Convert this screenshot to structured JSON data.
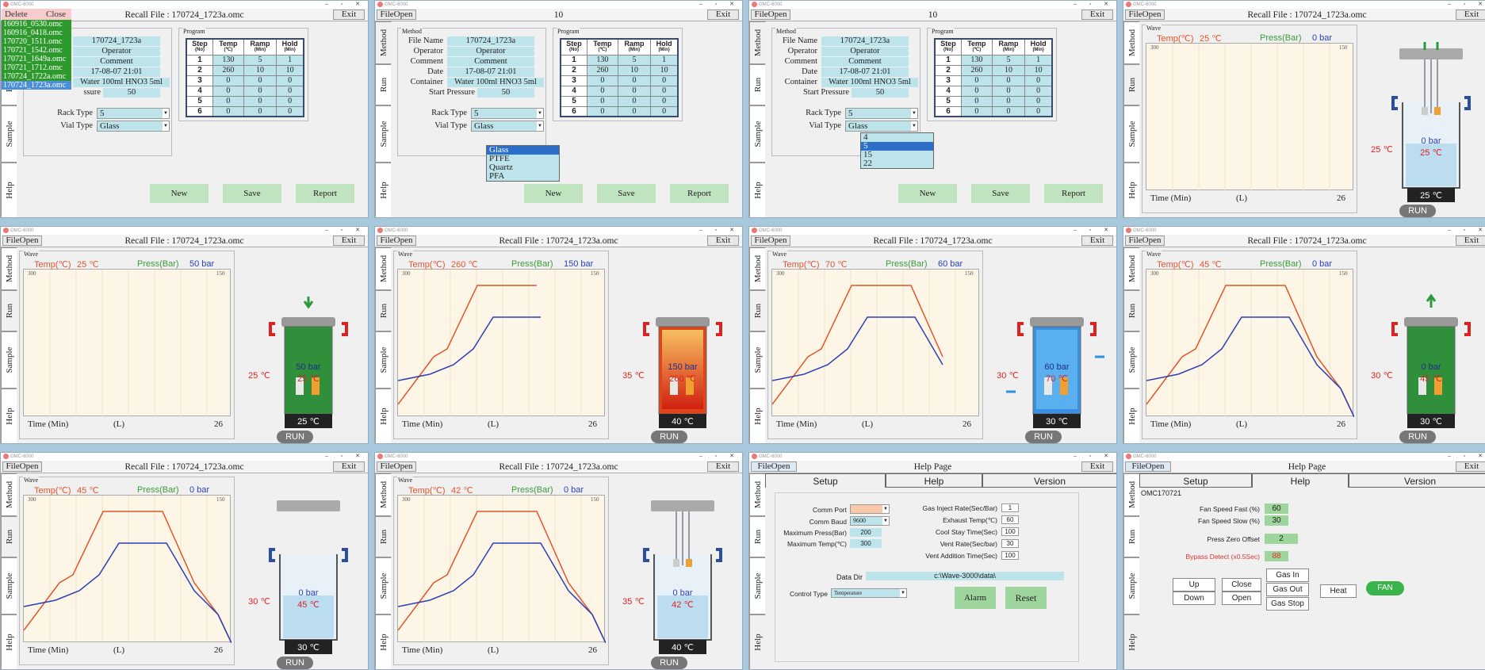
{
  "app": {
    "logo": "OMC-6000",
    "win_ctrls": "– ▫ ✕",
    "fileopen": "FileOpen",
    "exit": "Exit",
    "exit_alt": "Exit"
  },
  "side_tabs": {
    "method": "Method",
    "run": "Run",
    "sample": "Sample",
    "help": "Help"
  },
  "panels": {
    "p1": {
      "title": "Recall File : 170724_1723a.omc"
    },
    "p2": {
      "title": "10"
    },
    "p3": {
      "title": "10"
    },
    "p4": {
      "title": "Recall File : 170724_1723a.omc"
    },
    "p5": {
      "title": "Recall File : 170724_1723a.omc"
    },
    "p6": {
      "title": "Recall File : 170724_1723a.omc"
    },
    "p7": {
      "title": "Recall File : 170724_1723a.omc"
    },
    "p8": {
      "title": "Recall File : 170724_1723a.omc"
    },
    "p9": {
      "title": "Recall File : 170724_1723a.omc"
    },
    "p10": {
      "title": "Recall File : 170724_1723a.omc"
    },
    "p11": {
      "title": "Help Page"
    },
    "p12": {
      "title": "Help Page"
    }
  },
  "method": {
    "group": "Method",
    "program_group": "Program",
    "labels": {
      "file": "File Name",
      "operator": "Operator",
      "comment": "Comment",
      "date": "Date",
      "container": "Container",
      "pressure": "Start Pressure",
      "pressure_cut": "ssure",
      "container_cut": "Water 100ml HNO3 5ml",
      "rack": "Rack Type",
      "vial": "Vial Type"
    },
    "values": {
      "file": "170724_1723a",
      "operator": "Operator",
      "comment": "Comment",
      "date": "17-08-07 21:01",
      "container": "Water 100ml HNO3 5ml",
      "pressure": "50",
      "rack": "5",
      "vial": "Glass"
    },
    "headers": [
      [
        "Step",
        "(No)"
      ],
      [
        "Temp",
        "(℃)"
      ],
      [
        "Ramp",
        "(Min)"
      ],
      [
        "Hold",
        "(Min)"
      ]
    ],
    "rows": [
      [
        "1",
        "130",
        "5",
        "1"
      ],
      [
        "2",
        "260",
        "10",
        "10"
      ],
      [
        "3",
        "0",
        "0",
        "0"
      ],
      [
        "4",
        "0",
        "0",
        "0"
      ],
      [
        "5",
        "0",
        "0",
        "0"
      ],
      [
        "6",
        "0",
        "0",
        "0"
      ]
    ],
    "buttons": {
      "new": "New",
      "save": "Save",
      "report": "Report"
    },
    "vial_options": [
      "Glass",
      "PTFE",
      "Quartz",
      "PFA"
    ],
    "rack_options": [
      "4",
      "5",
      "15",
      "22"
    ]
  },
  "file_list": {
    "delete": "Delete",
    "close": "Close",
    "items": [
      "160916_0530.omc",
      "160916_0418.omc",
      "170720_1511.omc",
      "170721_1542.omc",
      "170721_1649a.omc",
      "170721_1712.omc",
      "170724_1722a.omc",
      "170724_1723a.omc"
    ]
  },
  "run": {
    "wave": "Wave",
    "temp_label": "Temp(℃)",
    "press_label": "Press(Bar)",
    "time_label": "Time (Min)",
    "time_unit": "(L)",
    "time_end": "26",
    "y_left_max": "300",
    "y_right_max": "150",
    "run_btn": "RUN",
    "states": {
      "p4": {
        "temp": "25 ℃",
        "press": "0 bar",
        "vessel_press": "0 bar",
        "vessel_temp": "25 ℃",
        "side_temp": "25 ℃",
        "base_temp": "25 ℃",
        "progress": 0
      },
      "p5": {
        "temp": "25 ℃",
        "press": "50 bar",
        "vessel_press": "50 bar",
        "vessel_temp": "25 ℃",
        "side_temp": "25 ℃",
        "base_temp": "25 ℃",
        "progress": 0
      },
      "p6": {
        "temp": "260 ℃",
        "press": "150 bar",
        "vessel_press": "150 bar",
        "vessel_temp": "260 ℃",
        "side_temp": "35 ℃",
        "base_temp": "40 ℃",
        "progress": 0.7
      },
      "p7": {
        "temp": "70 ℃",
        "press": "60 bar",
        "vessel_press": "60 bar",
        "vessel_temp": "70 ℃",
        "side_temp": "30 ℃",
        "base_temp": "30 ℃",
        "progress": 0.88
      },
      "p8": {
        "temp": "45 ℃",
        "press": "0 bar",
        "vessel_press": "0 bar",
        "vessel_temp": "45 ℃",
        "side_temp": "30 ℃",
        "base_temp": "30 ℃",
        "progress": 1
      },
      "p9": {
        "temp": "45 ℃",
        "press": "0 bar",
        "vessel_press": "0 bar",
        "vessel_temp": "45 ℃",
        "side_temp": "30 ℃",
        "base_temp": "30 ℃",
        "progress": 1
      },
      "p10": {
        "temp": "42 ℃",
        "press": "0 bar",
        "vessel_press": "0 bar",
        "vessel_temp": "42 ℃",
        "side_temp": "35 ℃",
        "base_temp": "40 ℃",
        "progress": 1
      }
    }
  },
  "help": {
    "tabs": [
      "Setup",
      "Help",
      "Version"
    ],
    "setup": {
      "comm_port": "Comm Port",
      "comm_baud": "Comm Baud",
      "comm_baud_val": "9600",
      "max_press": "Maximum Press(Bar)",
      "max_press_val": "200",
      "max_temp": "Maximum Temp(℃)",
      "max_temp_val": "300",
      "gas_rate": "Gas Inject Rate(Sec/Bar)",
      "gas_rate_val": "1",
      "exhaust": "Exhaust Temp(℃)",
      "exhaust_val": "60",
      "cool": "Cool Stay Time(Sec)",
      "cool_val": "100",
      "vent": "Vent Rate(Sec/bar)",
      "vent_val": "30",
      "vent_add": "Vent Addition Time(Sec)",
      "vent_add_val": "100",
      "data_dir": "Data Dir",
      "data_dir_val": "c:\\Wave-3000\\data\\",
      "control": "Control Type",
      "control_val": "Temperature",
      "alarm": "Alarm",
      "reset": "Reset"
    },
    "help": {
      "id": "OMC170721",
      "fan_fast": "Fan Speed Fast (%)",
      "fan_fast_val": "60",
      "fan_slow": "Fan Speed Slow (%)",
      "fan_slow_val": "30",
      "press_zero": "Press Zero Offset",
      "press_zero_val": "2",
      "bypass": "Bypass Detect (x0.5Sec)",
      "bypass_val": "88",
      "up": "Up",
      "down": "Down",
      "close": "Close",
      "open": "Open",
      "gas_in": "Gas In",
      "gas_out": "Gas Out",
      "gas_stop": "Gas Stop",
      "heat": "Heat",
      "fan": "FAN"
    }
  },
  "colors": {
    "temp": "#e0552a",
    "press": "#2a3fb8",
    "accent": "#bde4ea",
    "green": "#bfe4bf"
  }
}
